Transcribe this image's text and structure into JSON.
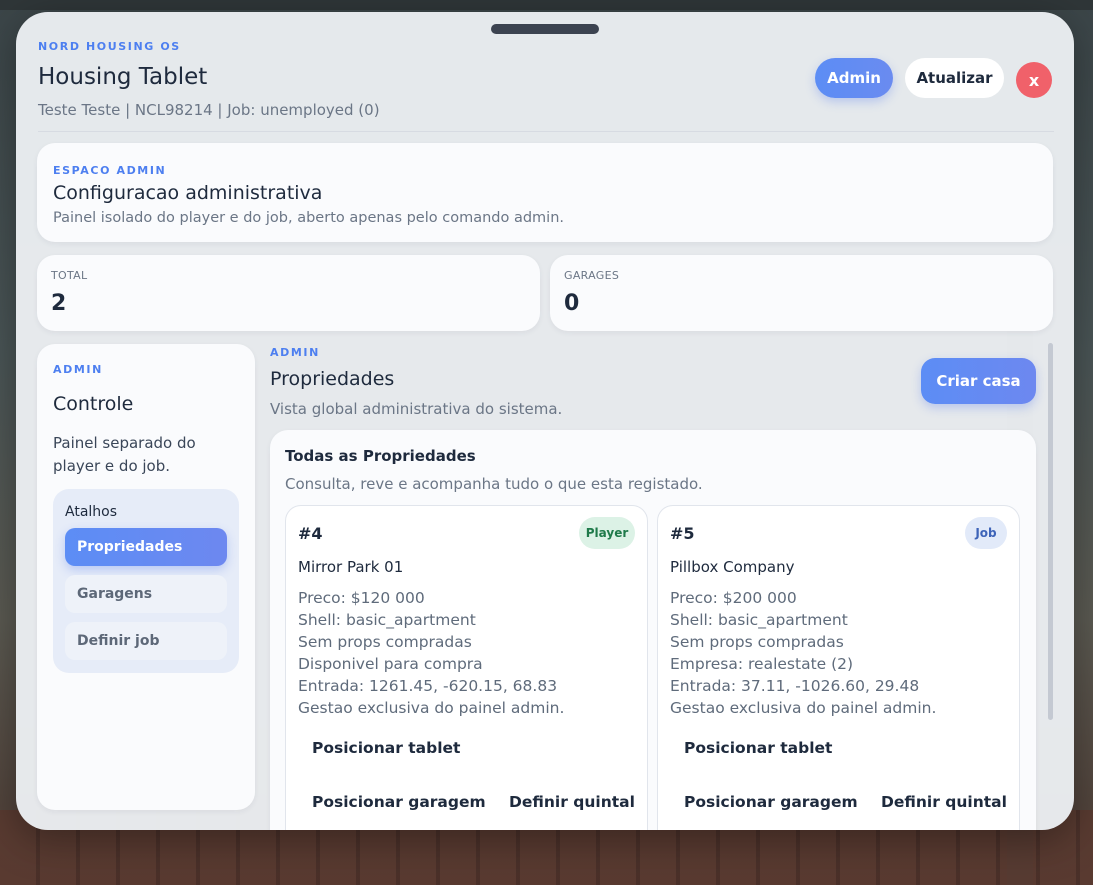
{
  "header": {
    "brand": "NORD HOUSING OS",
    "title": "Housing Tablet",
    "subtitle": "Teste Teste | NCL98214 | Job: unemployed (0)",
    "admin_label": "Admin",
    "refresh_label": "Atualizar",
    "close_label": "x"
  },
  "espaco": {
    "kicker": "ESPACO ADMIN",
    "title": "Configuracao administrativa",
    "description": "Painel isolado do player e do job, aberto apenas pelo comando admin."
  },
  "stats": {
    "total_label": "TOTAL",
    "total_value": "2",
    "garages_label": "GARAGES",
    "garages_value": "0"
  },
  "sidebar": {
    "kicker": "ADMIN",
    "title": "Controle",
    "description": "Painel separado do player e do job.",
    "shortcuts_label": "Atalhos",
    "items": [
      {
        "label": "Propriedades",
        "active": true
      },
      {
        "label": "Garagens",
        "active": false
      },
      {
        "label": "Definir job",
        "active": false
      }
    ]
  },
  "main": {
    "kicker": "ADMIN",
    "title": "Propriedades",
    "description": "Vista global administrativa do sistema.",
    "create_label": "Criar casa",
    "list_title": "Todas as Propriedades",
    "list_description": "Consulta, reve e acompanha tudo o que esta registado.",
    "properties": [
      {
        "id": "#4",
        "badge": "Player",
        "name": "Mirror Park 01",
        "lines": [
          "Preco: $120 000",
          "Shell: basic_apartment",
          "Sem props compradas",
          "Disponivel para compra",
          "Entrada: 1261.45, -620.15, 68.83",
          "Gestao exclusiva do painel admin."
        ],
        "actions": [
          "Posicionar tablet",
          "Posicionar garagem",
          "Definir quintal"
        ]
      },
      {
        "id": "#5",
        "badge": "Job",
        "name": "Pillbox Company",
        "lines": [
          "Preco: $200 000",
          "Shell: basic_apartment",
          "Sem props compradas",
          "Empresa: realestate (2)",
          "Entrada: 37.11, -1026.60, 29.48",
          "Gestao exclusiva do painel admin."
        ],
        "actions": [
          "Posicionar tablet",
          "Posicionar garagem",
          "Definir quintal"
        ]
      }
    ]
  },
  "colors": {
    "accent": "#5c8df5",
    "close": "#f0616a",
    "player_badge": "#dcf2e6",
    "job_badge": "#e2eaf9"
  }
}
